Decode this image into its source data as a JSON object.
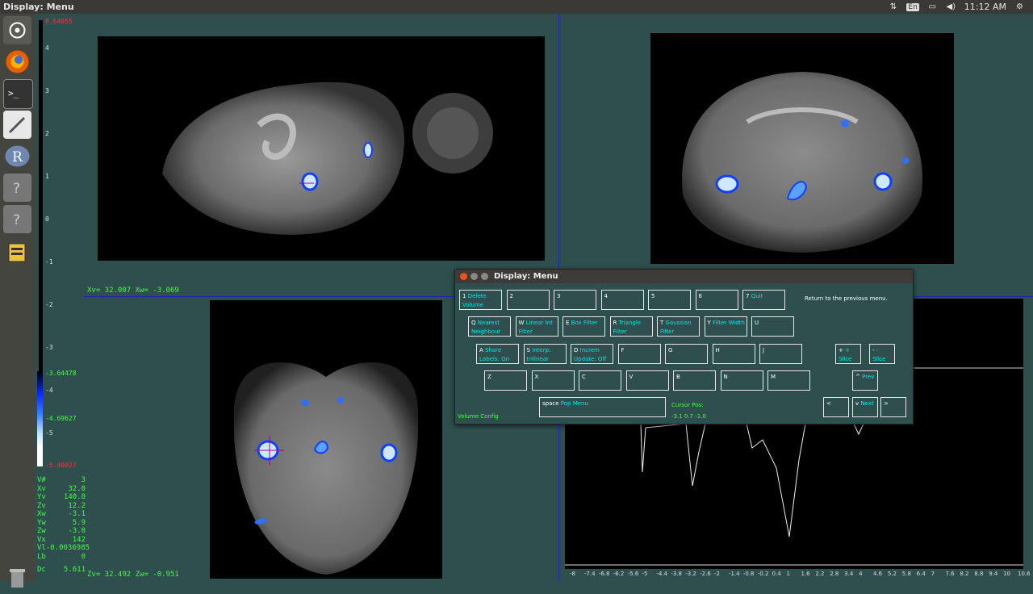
{
  "topbar": {
    "title": "Display: Menu",
    "lang": "En",
    "time": "11:12 AM"
  },
  "launcher": {
    "items": [
      "dash-home",
      "firefox",
      "terminal",
      "text-editor",
      "r-app",
      "unknown-app",
      "unknown-app",
      "file-app"
    ]
  },
  "colorbar": {
    "top_red": "8.64055",
    "ticks": [
      "4",
      "3",
      "2",
      "1",
      "0",
      "-1",
      "-2",
      "-3",
      "-4",
      "-5"
    ],
    "cut_low": "-3.64478",
    "cut_high": "-4.69627",
    "bottom_red": "-5.49027"
  },
  "coords": {
    "sagittal": "Xv=  32.007 Xw=  -3.069",
    "axial": "Zv=  32.492 Zw=  -0.951"
  },
  "info": [
    {
      "k": "V#",
      "v": "3"
    },
    {
      "k": "Xv",
      "v": "32.0"
    },
    {
      "k": "Yv",
      "v": "140.8"
    },
    {
      "k": "Zv",
      "v": "12.2"
    },
    {
      "k": "Xw",
      "v": "-3.1"
    },
    {
      "k": "Yw",
      "v": "5.9"
    },
    {
      "k": "Zw",
      "v": "-3.0"
    },
    {
      "k": "Vx",
      "v": "142"
    },
    {
      "k": "Vl",
      "v": "-0.0036985"
    },
    {
      "k": "Lb",
      "v": "0"
    },
    {
      "k": "Dc",
      "v": "5.611"
    }
  ],
  "plot_axis": [
    "-8",
    "-7.4",
    "-6.8",
    "-6.2",
    "-5.6",
    "-5",
    "-4.4",
    "-3.8",
    "-3.2",
    "-2.6",
    "-2",
    "-1.4",
    "-0.8",
    "-0.2",
    "0.4",
    "1",
    "1.6",
    "2.2",
    "2.8",
    "3.4",
    "4",
    "4.6",
    "5.2",
    "5.8",
    "6.4",
    "7",
    "7.6",
    "8.2",
    "8.8",
    "9.4",
    "10",
    "10.6"
  ],
  "menu": {
    "title": "Display: Menu",
    "help": "Return to the previous menu.",
    "volume_config": "Volume Config",
    "cursor_pos_label": "Cursor Pos:",
    "cursor_pos_value": "-3.1 0.7 -1.0",
    "rows": [
      [
        {
          "k": "1",
          "a": "Delete",
          "b": "Volume"
        },
        {
          "k": "2",
          "a": "",
          "b": ""
        },
        {
          "k": "3",
          "a": "",
          "b": ""
        },
        {
          "k": "4",
          "a": "",
          "b": ""
        },
        {
          "k": "5",
          "a": "",
          "b": ""
        },
        {
          "k": "6",
          "a": "",
          "b": ""
        },
        {
          "k": "7",
          "a": "Quit",
          "b": ""
        }
      ],
      [
        {
          "k": "Q",
          "a": "Nearest",
          "b": "Neighbour"
        },
        {
          "k": "W",
          "a": "Linear Int",
          "b": "Filter"
        },
        {
          "k": "E",
          "a": "Box Filter",
          "b": ""
        },
        {
          "k": "R",
          "a": "Triangle",
          "b": "Filter"
        },
        {
          "k": "T",
          "a": "Gaussian",
          "b": "Filter"
        },
        {
          "k": "Y",
          "a": "Filter Width",
          "b": ""
        },
        {
          "k": "U",
          "a": "",
          "b": ""
        }
      ],
      [
        {
          "k": "A",
          "a": "Share",
          "b": "Labels: On"
        },
        {
          "k": "S",
          "a": "Interp:",
          "b": "trilinear"
        },
        {
          "k": "D",
          "a": "Increm",
          "b": "Update: Off"
        },
        {
          "k": "F",
          "a": "",
          "b": ""
        },
        {
          "k": "G",
          "a": "",
          "b": ""
        },
        {
          "k": "H",
          "a": "",
          "b": ""
        },
        {
          "k": "J",
          "a": "",
          "b": ""
        }
      ],
      [
        {
          "k": "Z",
          "a": "",
          "b": ""
        },
        {
          "k": "X",
          "a": "",
          "b": ""
        },
        {
          "k": "C",
          "a": "",
          "b": ""
        },
        {
          "k": "V",
          "a": "",
          "b": ""
        },
        {
          "k": "B",
          "a": "",
          "b": ""
        },
        {
          "k": "N",
          "a": "",
          "b": ""
        },
        {
          "k": "M",
          "a": "",
          "b": ""
        }
      ]
    ],
    "slice_plus": {
      "k": "+",
      "a": "+",
      "b": "Slice"
    },
    "slice_minus": {
      "k": "-",
      "a": "-",
      "b": "Slice"
    },
    "prev": {
      "k": "^",
      "a": "Prev",
      "b": ""
    },
    "next": {
      "k": "v",
      "a": "Next",
      "b": ""
    },
    "left": {
      "k": "<",
      "a": "",
      "b": ""
    },
    "right": {
      "k": ">",
      "a": "",
      "b": ""
    },
    "space": {
      "k": "space",
      "a": "Pop Menu",
      "b": ""
    }
  }
}
